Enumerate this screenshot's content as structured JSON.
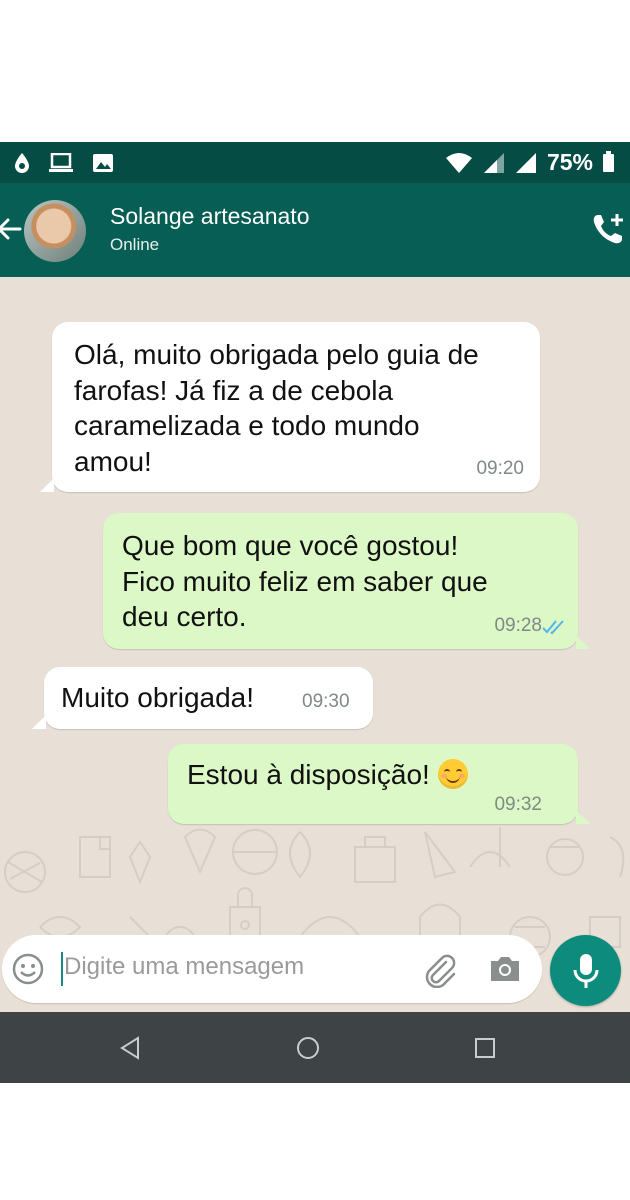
{
  "status_bar": {
    "battery_percent": "75%",
    "left_icons": [
      "water-drop-icon",
      "laptop-icon",
      "image-icon"
    ],
    "right_icons": [
      "wifi-icon",
      "signal-icon",
      "signal-icon",
      "battery-icon"
    ]
  },
  "header": {
    "contact_name": "Solange artesanato",
    "status": "Online",
    "icons": [
      "back-arrow-icon",
      "avatar",
      "add-call-icon"
    ]
  },
  "messages": [
    {
      "direction": "in",
      "lines": [
        "Olá, muito obrigada pelo guia de",
        "farofas! Já fiz a de cebola",
        "caramelizada e todo mundo",
        "amou!"
      ],
      "time": "09:20"
    },
    {
      "direction": "out",
      "lines": [
        "Que bom que você gostou!",
        "Fico muito feliz em saber que",
        "deu certo."
      ],
      "time": "09:28",
      "read": true
    },
    {
      "direction": "in",
      "lines": [
        "Muito obrigada!"
      ],
      "time": "09:30"
    },
    {
      "direction": "out",
      "lines": [
        "Estou à disposição!"
      ],
      "emoji": "smiling-face-emoji",
      "time": "09:32"
    }
  ],
  "composer": {
    "placeholder": "Digite uma mensagem",
    "icons": [
      "emoji-icon",
      "paperclip-icon",
      "camera-icon",
      "mic-icon"
    ]
  },
  "colors": {
    "status_bar": "#054c44",
    "header": "#075e54",
    "incoming_bubble": "#ffffff",
    "outgoing_bubble": "#dcf8c6",
    "mic_button": "#0d8c7d",
    "read_ticks": "#4fb6ec"
  }
}
